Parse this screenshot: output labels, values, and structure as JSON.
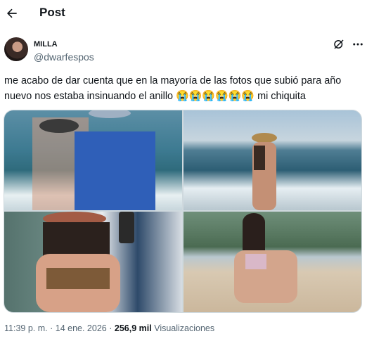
{
  "header": {
    "title": "Post"
  },
  "post": {
    "author_name": "MILLA",
    "author_handle": "@dwarfespos",
    "text": "me acabo de dar cuenta que en la mayoría de las fotos que subió para año nuevo nos estaba insinuando el anillo",
    "emojis": "😭😭😭😭😭😭",
    "text_tail": "mi chiquita",
    "time": "11:39 p. m.",
    "separator": "·",
    "date": "14 ene. 2026",
    "views_count": "256,9 mil",
    "views_label": "Visualizaciones"
  },
  "icons": {
    "back": "arrow-left-icon",
    "grok": "grok-icon",
    "more": "more-icon"
  },
  "media": [
    {
      "name": "photo-1"
    },
    {
      "name": "photo-2"
    },
    {
      "name": "photo-3"
    },
    {
      "name": "photo-4"
    }
  ]
}
